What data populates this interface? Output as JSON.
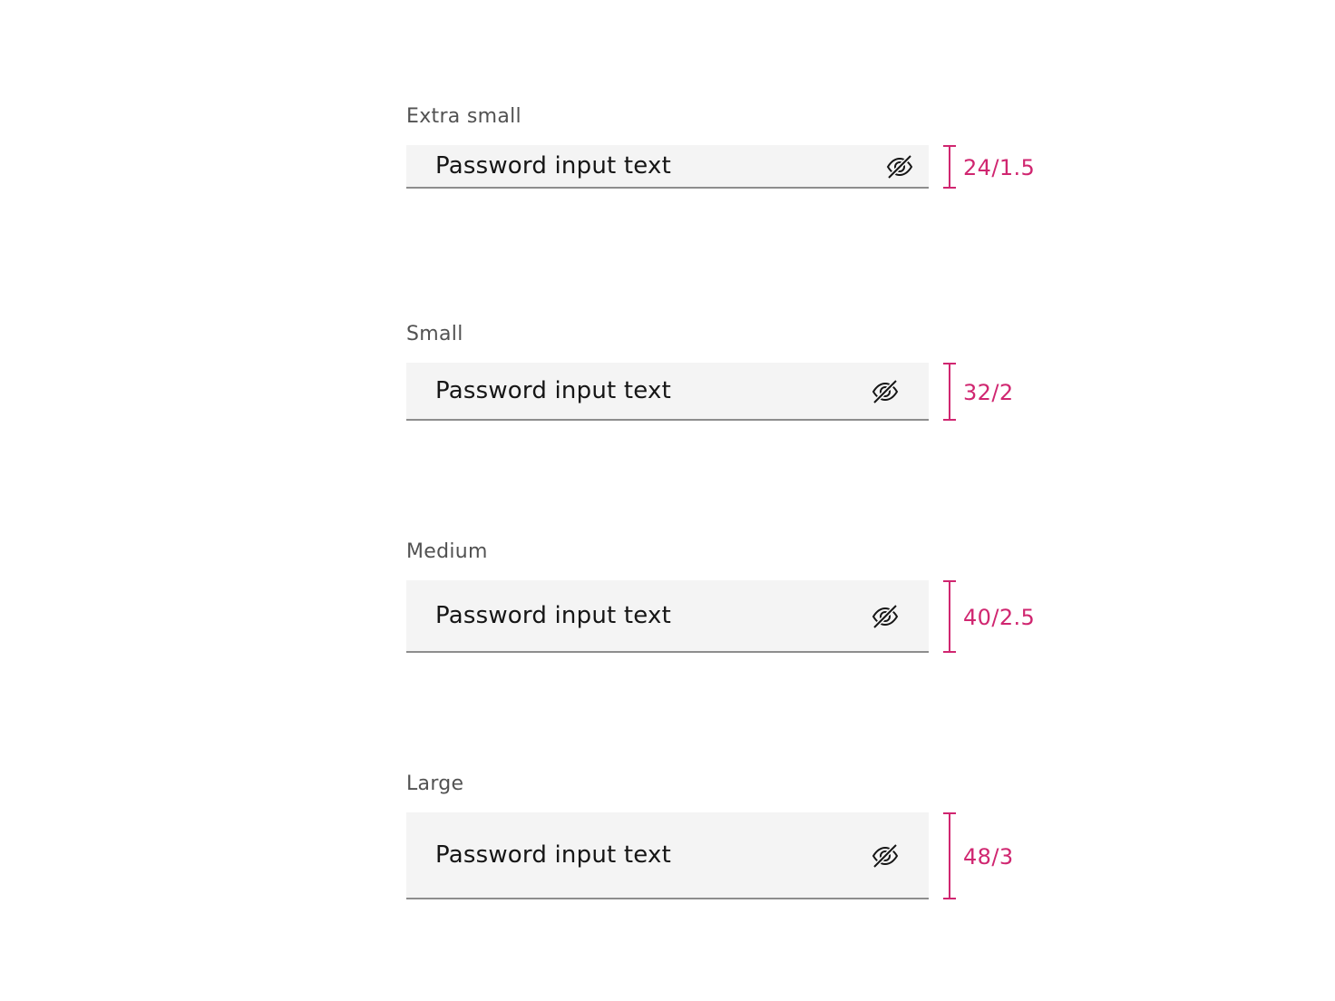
{
  "accent_color": "#d02670",
  "fields": [
    {
      "size_label": "Extra small",
      "value": "Password input text",
      "icon": "eye-off-icon",
      "spec": "24/1.5"
    },
    {
      "size_label": "Small",
      "value": "Password input text",
      "icon": "eye-off-icon",
      "spec": "32/2"
    },
    {
      "size_label": "Medium",
      "value": "Password input text",
      "icon": "eye-off-icon",
      "spec": "40/2.5"
    },
    {
      "size_label": "Large",
      "value": "Password input text",
      "icon": "eye-off-icon",
      "spec": "48/3"
    }
  ]
}
